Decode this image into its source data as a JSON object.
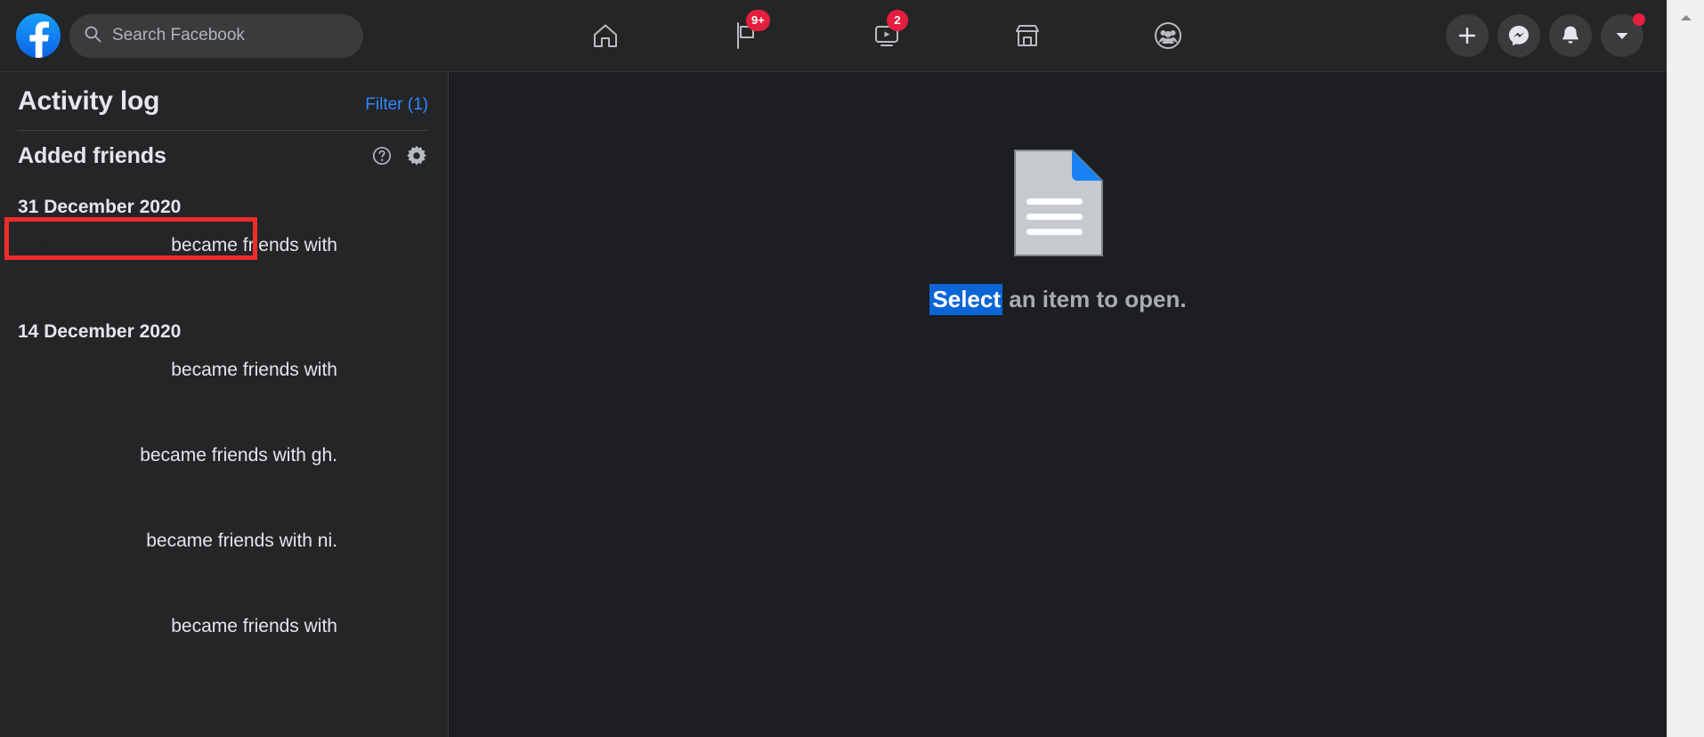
{
  "topbar": {
    "logo_name": "Facebook",
    "search": {
      "placeholder": "Search Facebook",
      "value": "",
      "icon": "search-icon"
    },
    "nav": [
      {
        "name": "home",
        "icon": "home-icon",
        "badge": ""
      },
      {
        "name": "pages",
        "icon": "flag-icon",
        "badge": "9+"
      },
      {
        "name": "watch",
        "icon": "video-icon",
        "badge": "2"
      },
      {
        "name": "marketplace",
        "icon": "storefront-icon",
        "badge": ""
      },
      {
        "name": "groups",
        "icon": "groups-icon",
        "badge": ""
      }
    ],
    "actions": [
      {
        "name": "create",
        "icon": "plus-icon",
        "dot": false
      },
      {
        "name": "messenger",
        "icon": "messenger-icon",
        "dot": false
      },
      {
        "name": "notifications",
        "icon": "bell-icon",
        "dot": false
      },
      {
        "name": "account-menu",
        "icon": "chevron-down-icon",
        "dot": true
      }
    ],
    "dot_color": "#e41e3f",
    "badge_color": "#e41e3f"
  },
  "sidebar": {
    "title": "Activity log",
    "filter_label": "Filter (1)",
    "filter_color": "#2d88ff",
    "section": {
      "title": "Added friends",
      "help_icon": "help-circle-icon",
      "settings_icon": "gear-icon",
      "highlight_color": "#ef2b2b"
    },
    "groups": [
      {
        "date": "31 December 2020",
        "entries": [
          {
            "text": "became friends with",
            "avatar": "avatar-placeholder"
          }
        ]
      },
      {
        "date": "14 December 2020",
        "entries": [
          {
            "text": "became friends with",
            "avatar": "avatar-placeholder"
          },
          {
            "text": "became friends with\ngh.",
            "avatar": "avatar-placeholder"
          },
          {
            "text": "became friends with\nni.",
            "avatar": "avatar-placeholder"
          },
          {
            "text": "became friends with",
            "avatar": "avatar-placeholder"
          }
        ]
      }
    ]
  },
  "main": {
    "empty_state": {
      "icon": "document-icon",
      "selected_word": "Select",
      "rest_text": " an item to open.",
      "selection_color": "#0b65d6"
    }
  },
  "scrollbar": {
    "up_arrow_icon": "caret-up-icon"
  }
}
